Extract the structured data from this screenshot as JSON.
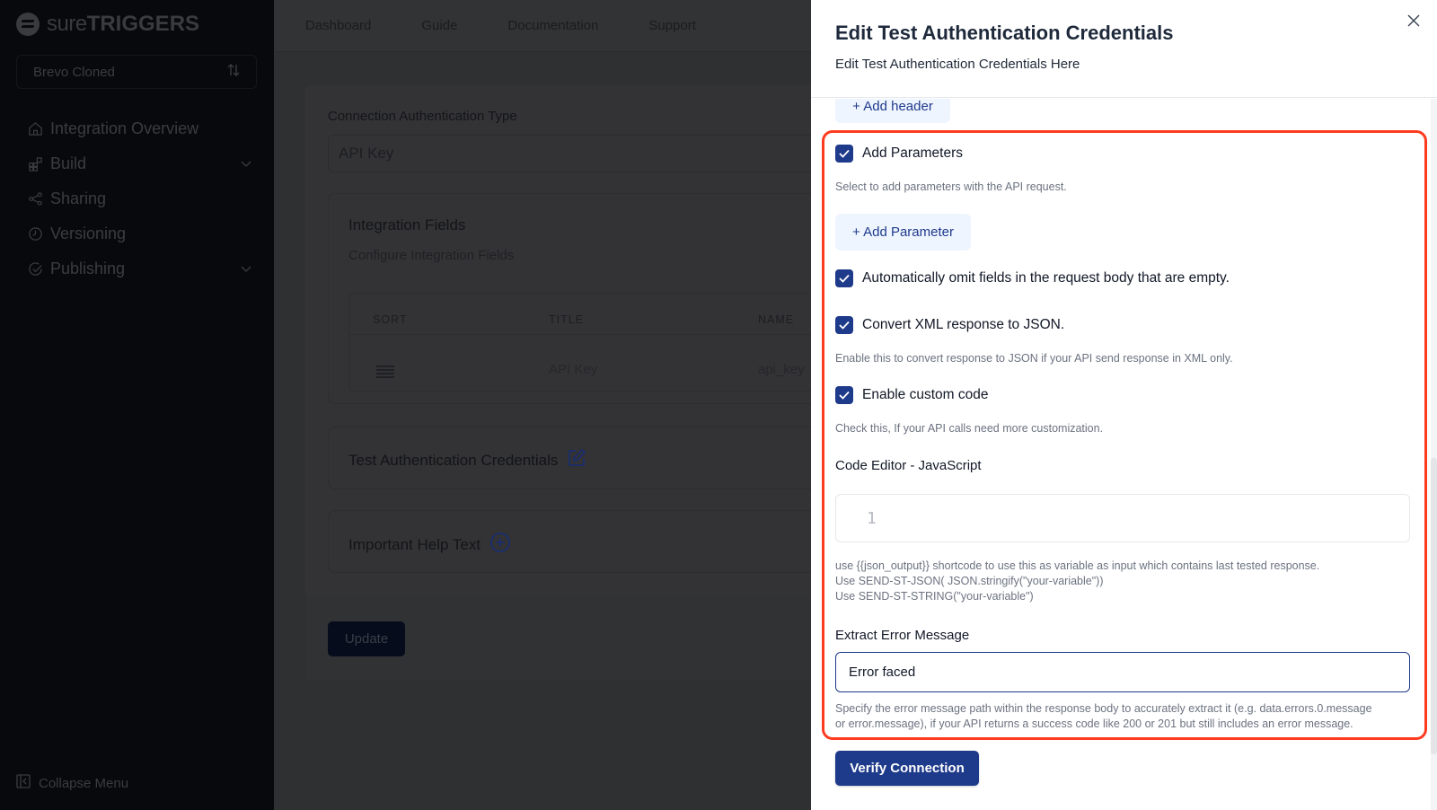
{
  "sidebar": {
    "logo": {
      "light": "sure",
      "bold": "TRIGGERS"
    },
    "workspace": {
      "name": "Brevo Cloned",
      "switch_icon": "sort-arrows-icon"
    },
    "items": [
      {
        "label": "Integration Overview",
        "icon": "home-icon",
        "expandable": false
      },
      {
        "label": "Build",
        "icon": "blocks-icon",
        "expandable": true
      },
      {
        "label": "Sharing",
        "icon": "share-icon",
        "expandable": false
      },
      {
        "label": "Versioning",
        "icon": "clock-icon",
        "expandable": false
      },
      {
        "label": "Publishing",
        "icon": "check-circle-icon",
        "expandable": true
      }
    ],
    "collapse_label": "Collapse Menu"
  },
  "topnav": {
    "links": [
      "Dashboard",
      "Guide",
      "Documentation",
      "Support"
    ]
  },
  "main": {
    "auth_type_label": "Connection Authentication Type",
    "auth_type_value": "API Key",
    "integration_fields": {
      "title": "Integration Fields",
      "subtitle": "Configure Integration Fields",
      "columns": [
        "SORT",
        "TITLE",
        "NAME"
      ],
      "rows": [
        {
          "title": "API Key",
          "name": "api_key"
        }
      ]
    },
    "test_auth_title": "Test Authentication Credentials",
    "help_text_title": "Important Help Text",
    "update_label": "Update"
  },
  "drawer": {
    "title": "Edit Test Authentication Credentials",
    "subtitle": "Edit Test Authentication Credentials Here",
    "add_header_label": "+ Add header",
    "add_parameters": {
      "label": "Add Parameters",
      "checked": true,
      "help": "Select to add parameters with the API request."
    },
    "add_parameter_button": "+ Add Parameter",
    "omit_empty": {
      "label": "Automatically omit fields in the request body that are empty.",
      "checked": true
    },
    "convert_xml": {
      "label": "Convert XML response to JSON.",
      "checked": true,
      "help": "Enable this to convert response to JSON if your API send response in XML only."
    },
    "custom_code": {
      "label": "Enable custom code",
      "checked": true,
      "help": "Check this, If your API calls need more customization."
    },
    "code_editor": {
      "label": "Code Editor - JavaScript",
      "line_number": "1",
      "help_lines": [
        "use {{json_output}} shortcode to use this as variable as input which contains last tested response.",
        "Use SEND-ST-JSON( JSON.stringify(\"your-variable\"))",
        "Use SEND-ST-STRING(\"your-variable\")"
      ]
    },
    "extract_error": {
      "label": "Extract Error Message",
      "value": "Error faced",
      "help_lines": [
        "Specify the error message path within the response body to accurately extract it (e.g. data.errors.0.message",
        "or error.message), if your API returns a success code like 200 or 201 but still includes an error message."
      ]
    },
    "verify_label": "Verify Connection",
    "colors": {
      "primary": "#1e3a8a",
      "highlight": "#ff3b1f"
    }
  }
}
